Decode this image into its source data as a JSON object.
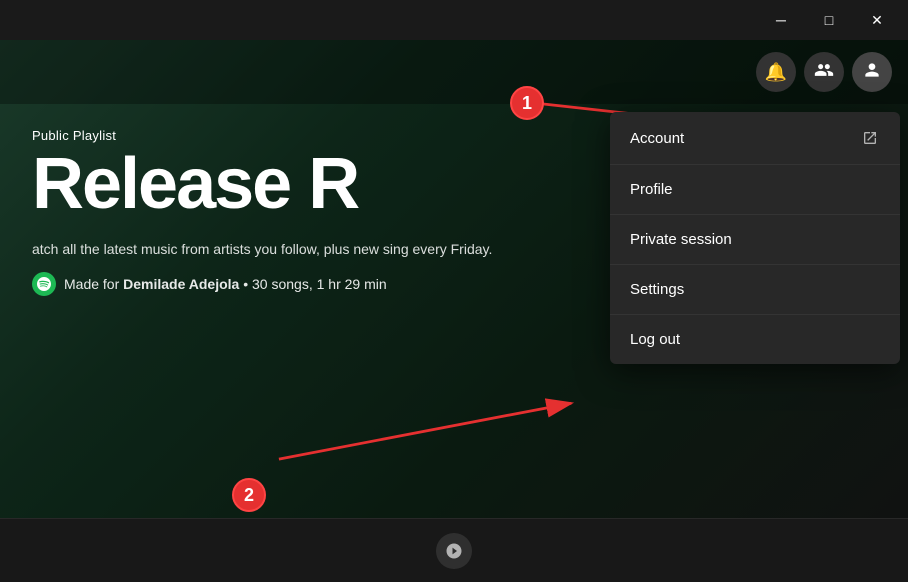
{
  "titleBar": {
    "minimize_label": "─",
    "maximize_label": "□",
    "close_label": "✕"
  },
  "header": {
    "bell_icon": "🔔",
    "friend_icon": "👤",
    "user_icon": "👤"
  },
  "playlist": {
    "subtitle": "Public Playlist",
    "title": "Release R",
    "description": "atch all the latest music from artists you follow, plus new sing\nevery Friday.",
    "made_for_label": "Made for",
    "creator_name": "Demilade Adejola",
    "songs_count": "30 songs, 1 hr 29 min"
  },
  "annotations": {
    "one": "1",
    "two": "2"
  },
  "dropdown": {
    "items": [
      {
        "label": "Account",
        "icon": "external"
      },
      {
        "label": "Profile",
        "icon": ""
      },
      {
        "label": "Private session",
        "icon": ""
      },
      {
        "label": "Settings",
        "icon": ""
      },
      {
        "label": "Log out",
        "icon": ""
      }
    ]
  }
}
